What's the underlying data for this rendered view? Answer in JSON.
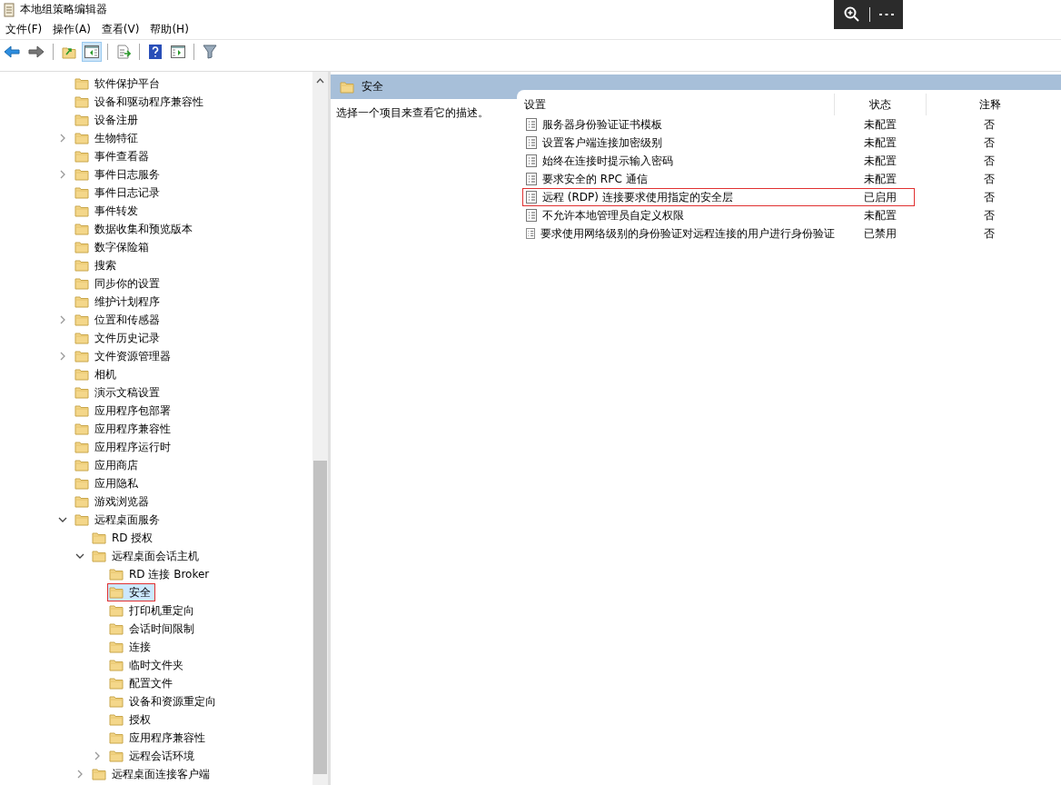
{
  "window": {
    "title": "本地组策略编辑器"
  },
  "menu": [
    "文件(F)",
    "操作(A)",
    "查看(V)",
    "帮助(H)"
  ],
  "toolbar": [
    {
      "kind": "back",
      "selected": false
    },
    {
      "kind": "forward",
      "selected": false
    },
    {
      "kind": "sep"
    },
    {
      "kind": "up",
      "selected": false
    },
    {
      "kind": "tree",
      "selected": true
    },
    {
      "kind": "sep"
    },
    {
      "kind": "export",
      "selected": false
    },
    {
      "kind": "sep"
    },
    {
      "kind": "help",
      "selected": false
    },
    {
      "kind": "pane",
      "selected": false
    },
    {
      "kind": "sep"
    },
    {
      "kind": "filter",
      "selected": false
    }
  ],
  "tree": [
    {
      "label": "软件保护平台",
      "expandable": false,
      "expanded": false,
      "selected": false,
      "highlighted": false
    },
    {
      "label": "设备和驱动程序兼容性",
      "expandable": false,
      "expanded": false,
      "selected": false,
      "highlighted": false
    },
    {
      "label": "设备注册",
      "expandable": false,
      "expanded": false,
      "selected": false,
      "highlighted": false
    },
    {
      "label": "生物特征",
      "expandable": true,
      "expanded": false,
      "selected": false,
      "highlighted": false
    },
    {
      "label": "事件查看器",
      "expandable": false,
      "expanded": false,
      "selected": false,
      "highlighted": false
    },
    {
      "label": "事件日志服务",
      "expandable": true,
      "expanded": false,
      "selected": false,
      "highlighted": false
    },
    {
      "label": "事件日志记录",
      "expandable": false,
      "expanded": false,
      "selected": false,
      "highlighted": false
    },
    {
      "label": "事件转发",
      "expandable": false,
      "expanded": false,
      "selected": false,
      "highlighted": false
    },
    {
      "label": "数据收集和预览版本",
      "expandable": false,
      "expanded": false,
      "selected": false,
      "highlighted": false
    },
    {
      "label": "数字保险箱",
      "expandable": false,
      "expanded": false,
      "selected": false,
      "highlighted": false
    },
    {
      "label": "搜索",
      "expandable": false,
      "expanded": false,
      "selected": false,
      "highlighted": false
    },
    {
      "label": "同步你的设置",
      "expandable": false,
      "expanded": false,
      "selected": false,
      "highlighted": false
    },
    {
      "label": "维护计划程序",
      "expandable": false,
      "expanded": false,
      "selected": false,
      "highlighted": false
    },
    {
      "label": "位置和传感器",
      "expandable": true,
      "expanded": false,
      "selected": false,
      "highlighted": false
    },
    {
      "label": "文件历史记录",
      "expandable": false,
      "expanded": false,
      "selected": false,
      "highlighted": false
    },
    {
      "label": "文件资源管理器",
      "expandable": true,
      "expanded": false,
      "selected": false,
      "highlighted": false
    },
    {
      "label": "相机",
      "expandable": false,
      "expanded": false,
      "selected": false,
      "highlighted": false
    },
    {
      "label": "演示文稿设置",
      "expandable": false,
      "expanded": false,
      "selected": false,
      "highlighted": false
    },
    {
      "label": "应用程序包部署",
      "expandable": false,
      "expanded": false,
      "selected": false,
      "highlighted": false
    },
    {
      "label": "应用程序兼容性",
      "expandable": false,
      "expanded": false,
      "selected": false,
      "highlighted": false
    },
    {
      "label": "应用程序运行时",
      "expandable": false,
      "expanded": false,
      "selected": false,
      "highlighted": false
    },
    {
      "label": "应用商店",
      "expandable": false,
      "expanded": false,
      "selected": false,
      "highlighted": false
    },
    {
      "label": "应用隐私",
      "expandable": false,
      "expanded": false,
      "selected": false,
      "highlighted": false
    },
    {
      "label": "游戏浏览器",
      "expandable": false,
      "expanded": false,
      "selected": false,
      "highlighted": false
    },
    {
      "label": "远程桌面服务",
      "expandable": true,
      "expanded": true,
      "selected": false,
      "highlighted": false,
      "children": [
        {
          "label": "RD 授权",
          "expandable": false,
          "expanded": false,
          "selected": false,
          "highlighted": false
        },
        {
          "label": "远程桌面会话主机",
          "expandable": true,
          "expanded": true,
          "selected": false,
          "highlighted": false,
          "children": [
            {
              "label": "RD 连接 Broker",
              "expandable": false,
              "expanded": false,
              "selected": false,
              "highlighted": false
            },
            {
              "label": "安全",
              "expandable": false,
              "expanded": false,
              "selected": true,
              "highlighted": true
            },
            {
              "label": "打印机重定向",
              "expandable": false,
              "expanded": false,
              "selected": false,
              "highlighted": false
            },
            {
              "label": "会话时间限制",
              "expandable": false,
              "expanded": false,
              "selected": false,
              "highlighted": false
            },
            {
              "label": "连接",
              "expandable": false,
              "expanded": false,
              "selected": false,
              "highlighted": false
            },
            {
              "label": "临时文件夹",
              "expandable": false,
              "expanded": false,
              "selected": false,
              "highlighted": false
            },
            {
              "label": "配置文件",
              "expandable": false,
              "expanded": false,
              "selected": false,
              "highlighted": false
            },
            {
              "label": "设备和资源重定向",
              "expandable": false,
              "expanded": false,
              "selected": false,
              "highlighted": false
            },
            {
              "label": "授权",
              "expandable": false,
              "expanded": false,
              "selected": false,
              "highlighted": false
            },
            {
              "label": "应用程序兼容性",
              "expandable": false,
              "expanded": false,
              "selected": false,
              "highlighted": false
            },
            {
              "label": "远程会话环境",
              "expandable": true,
              "expanded": false,
              "selected": false,
              "highlighted": false
            }
          ]
        },
        {
          "label": "远程桌面连接客户端",
          "expandable": true,
          "expanded": false,
          "selected": false,
          "highlighted": false
        }
      ]
    }
  ],
  "detail": {
    "title": "安全",
    "description": "选择一个项目来查看它的描述。",
    "columns": [
      "设置",
      "状态",
      "注释"
    ],
    "rows": [
      {
        "setting": "服务器身份验证证书模板",
        "state": "未配置",
        "comment": "否",
        "highlighted": false
      },
      {
        "setting": "设置客户端连接加密级别",
        "state": "未配置",
        "comment": "否",
        "highlighted": false
      },
      {
        "setting": "始终在连接时提示输入密码",
        "state": "未配置",
        "comment": "否",
        "highlighted": false
      },
      {
        "setting": "要求安全的 RPC 通信",
        "state": "未配置",
        "comment": "否",
        "highlighted": false
      },
      {
        "setting": "远程 (RDP) 连接要求使用指定的安全层",
        "state": "已启用",
        "comment": "否",
        "highlighted": true
      },
      {
        "setting": "不允许本地管理员自定义权限",
        "state": "未配置",
        "comment": "否",
        "highlighted": false
      },
      {
        "setting": "要求使用网络级别的身份验证对远程连接的用户进行身份验证",
        "state": "已禁用",
        "comment": "否",
        "highlighted": false
      }
    ]
  }
}
